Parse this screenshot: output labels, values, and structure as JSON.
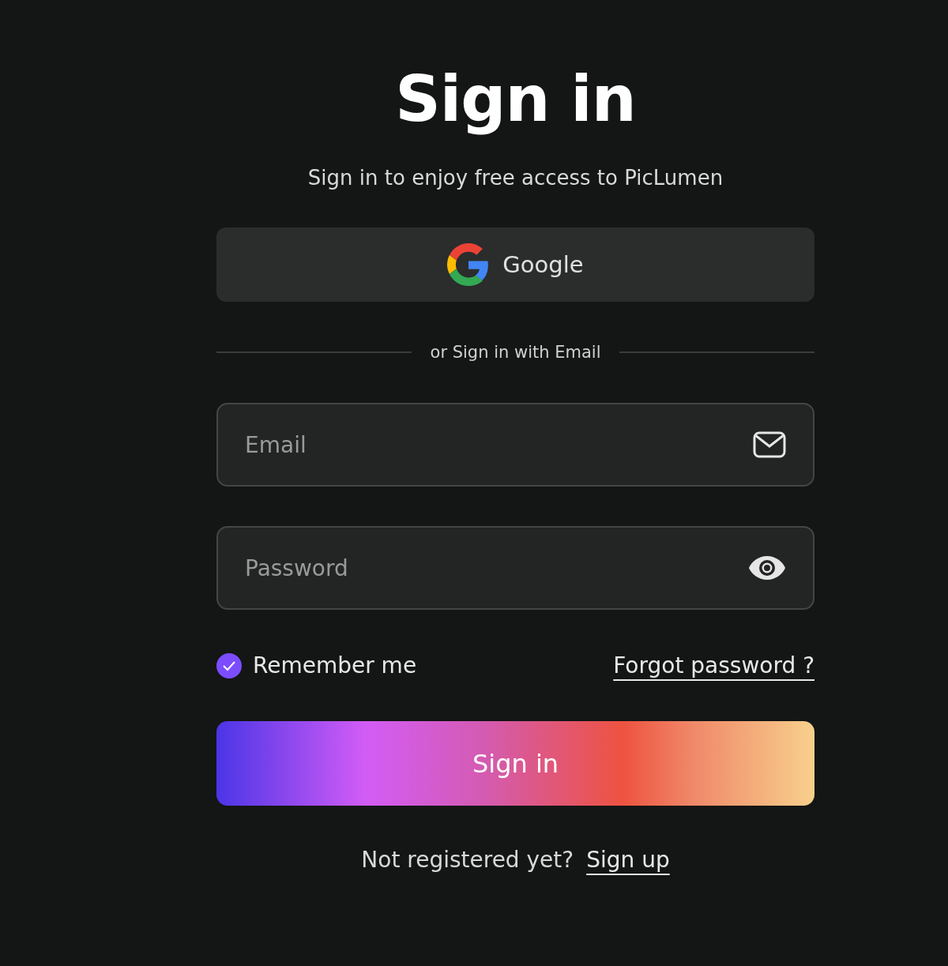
{
  "title": "Sign in",
  "subtitle": "Sign in to enjoy free access to PicLumen",
  "google_button": {
    "label": "Google"
  },
  "divider_text": "or Sign in with Email",
  "email": {
    "placeholder": "Email"
  },
  "password": {
    "placeholder": "Password"
  },
  "remember": {
    "label": "Remember me",
    "checked": true
  },
  "forgot_link": "Forgot password ?",
  "submit": {
    "label": "Sign in"
  },
  "footer": {
    "text": "Not registered yet?",
    "link": "Sign up"
  }
}
